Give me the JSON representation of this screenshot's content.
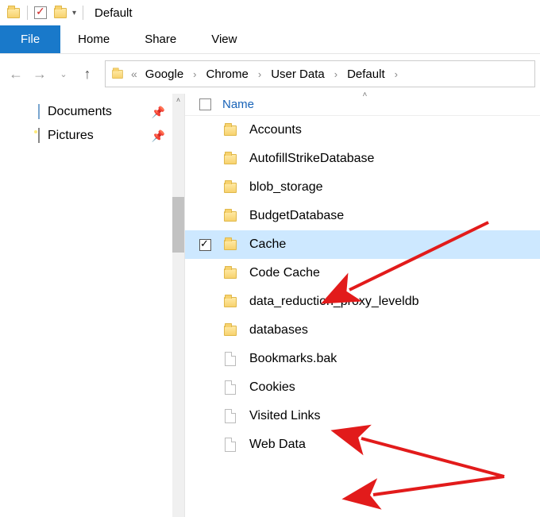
{
  "titlebar": {
    "title": "Default"
  },
  "ribbon": {
    "file": "File",
    "tabs": [
      "Home",
      "Share",
      "View"
    ]
  },
  "breadcrumbs": [
    "Google",
    "Chrome",
    "User Data",
    "Default"
  ],
  "sidebar": {
    "items": [
      {
        "label": "Documents",
        "icon": "document",
        "pinned": true
      },
      {
        "label": "Pictures",
        "icon": "picture",
        "pinned": true
      }
    ]
  },
  "content": {
    "column_header": "Name",
    "items": [
      {
        "name": "Accounts",
        "type": "folder",
        "selected": false
      },
      {
        "name": "AutofillStrikeDatabase",
        "type": "folder",
        "selected": false
      },
      {
        "name": "blob_storage",
        "type": "folder",
        "selected": false
      },
      {
        "name": "BudgetDatabase",
        "type": "folder",
        "selected": false
      },
      {
        "name": "Cache",
        "type": "folder",
        "selected": true
      },
      {
        "name": "Code Cache",
        "type": "folder",
        "selected": false
      },
      {
        "name": "data_reduction_proxy_leveldb",
        "type": "folder",
        "selected": false
      },
      {
        "name": "databases",
        "type": "folder",
        "selected": false
      },
      {
        "name": "Bookmarks.bak",
        "type": "file",
        "selected": false
      },
      {
        "name": "Cookies",
        "type": "file",
        "selected": false
      },
      {
        "name": "Visited Links",
        "type": "file",
        "selected": false
      },
      {
        "name": "Web Data",
        "type": "file",
        "selected": false
      }
    ]
  }
}
